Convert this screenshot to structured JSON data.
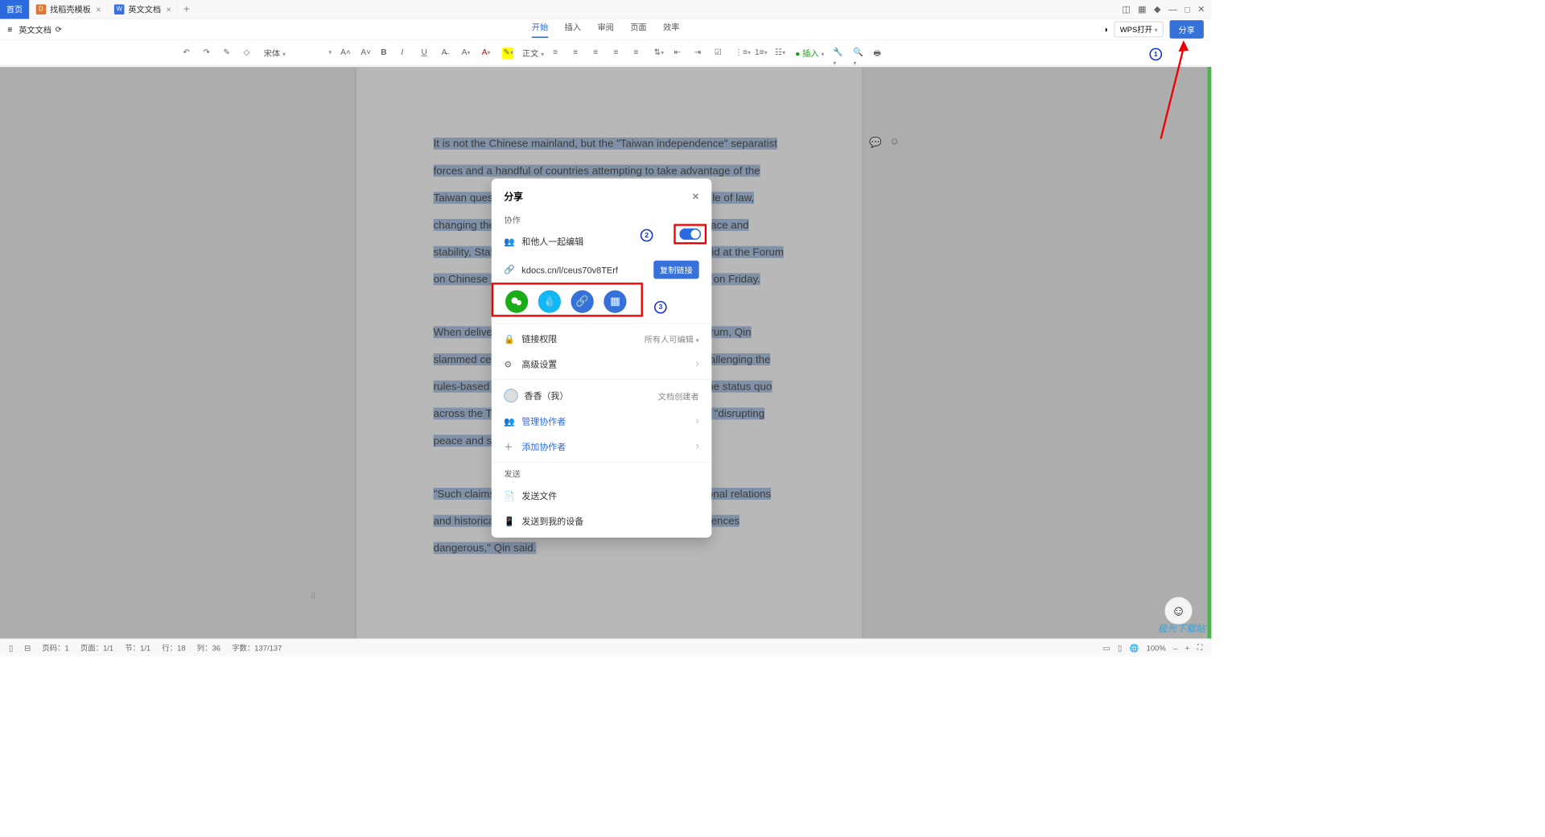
{
  "titlebar": {
    "tabs": [
      {
        "label": "首页",
        "active": true
      },
      {
        "label": "找稻壳模板",
        "icon": "orange"
      },
      {
        "label": "英文文档",
        "icon": "blue"
      }
    ]
  },
  "subheader": {
    "filename": "英文文档",
    "menus": [
      "开始",
      "插入",
      "审阅",
      "页面",
      "效率"
    ],
    "activeMenu": 0,
    "wpsopen": "WPS打开",
    "share": "分享"
  },
  "toolbar": {
    "font": "宋体",
    "style_label": "正文"
  },
  "document": {
    "p1": "It is not the Chinese mainland, but the \"Taiwan independence\" separatist forces and a handful of countries attempting to take advantage of the Taiwan question that are actually disrupting international rule of law, changing the status quo, and undermining cross-Straits peace and stability, State Councilor and Foreign Minister Qin Gang said at the Forum on Chinese Modernization and the World held in Shanghai on Friday.",
    "p2": "When delivering a keynote speech at the opening of the forum, Qin slammed certain countries that have accused China of \"challenging the rules-based international order,\" of \"unilaterally changing the status quo across the Taiwan Straits through force or coercion\" and of \"disrupting peace and stability across the Taiwan Straits\".",
    "p3": "\"Such claims go against basic common sense on international relations and historical justice. The logic is absurd, and the consequences dangerous,\" Qin said."
  },
  "dialog": {
    "title": "分享",
    "section1": "协作",
    "collab_label": "和他人一起编辑",
    "link": "kdocs.cn/l/ceus70v8TErf",
    "copy": "复制链接",
    "perm_label": "链接权限",
    "perm_value": "所有人可编辑",
    "advanced": "高级设置",
    "user": "香香（我）",
    "user_role": "文档创建者",
    "manage": "管理协作者",
    "add": "添加协作者",
    "section2": "发送",
    "send_file": "发送文件",
    "send_device": "发送到我的设备"
  },
  "callouts": {
    "c1": "1",
    "c2": "2",
    "c3": "3"
  },
  "statusbar": {
    "page": "页码：1",
    "pages": "页面：1/1",
    "section": "节：1/1",
    "line": "行：18",
    "col": "列：36",
    "words": "字数：137/137",
    "zoom": "100%"
  },
  "watermark": "极光下载站"
}
